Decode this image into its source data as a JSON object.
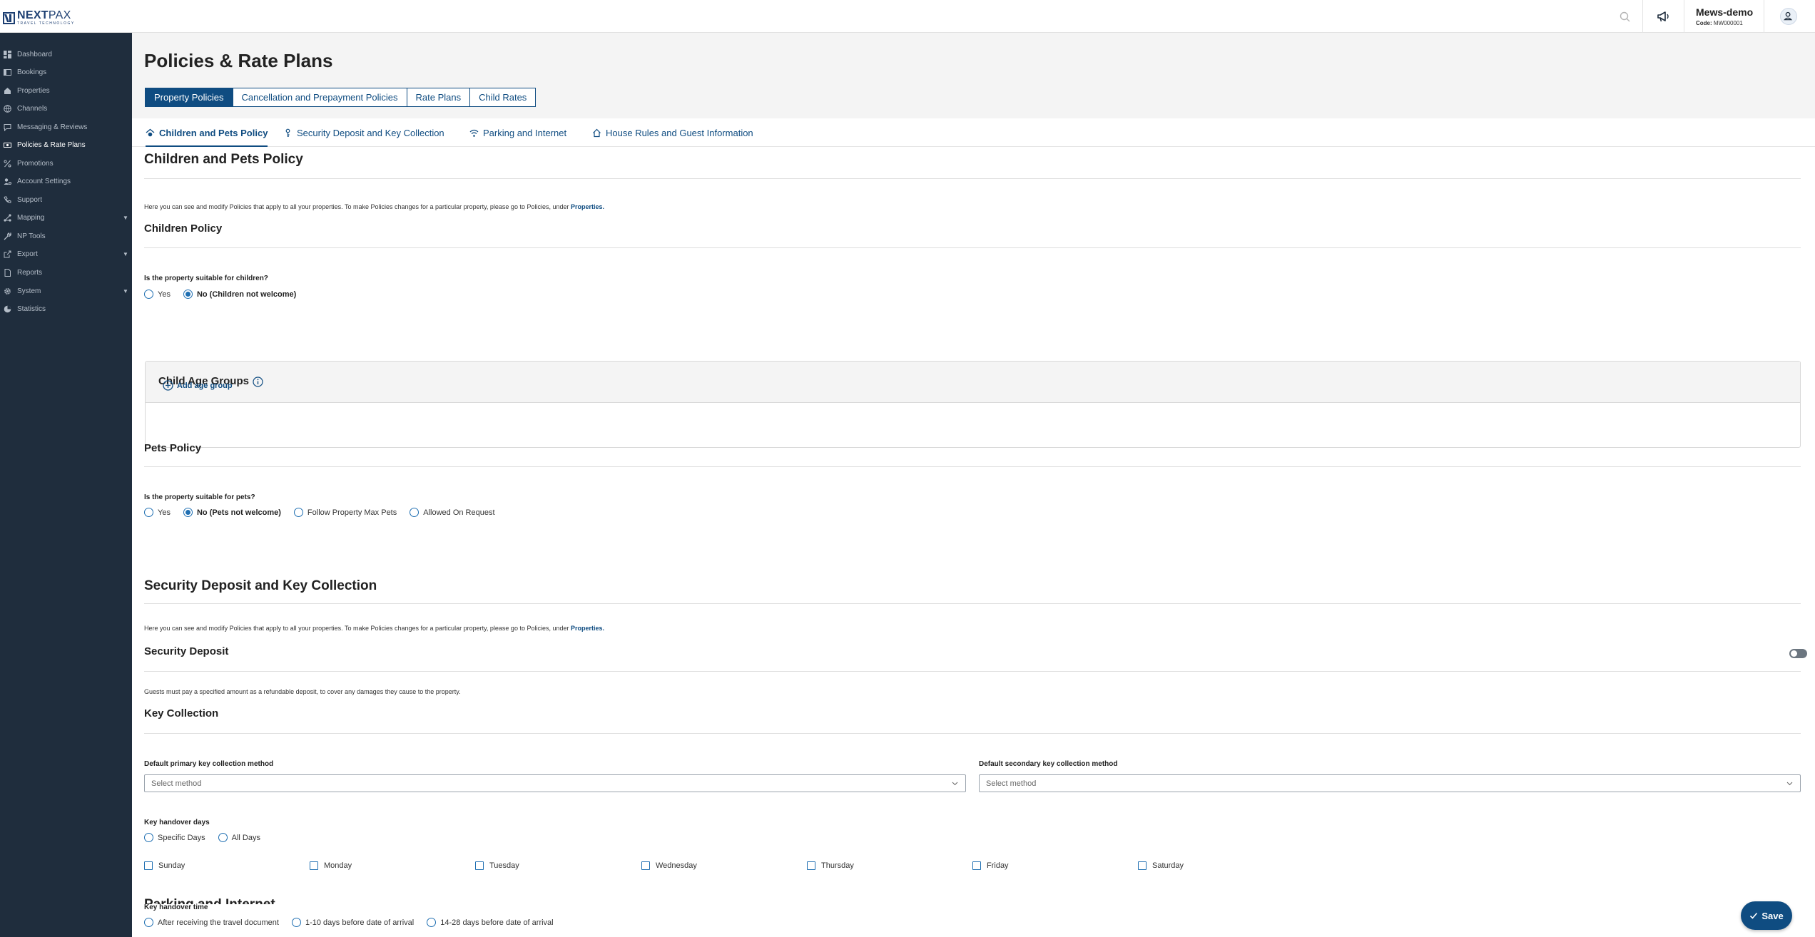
{
  "brand": {
    "name_bold": "NEXT",
    "name_light": "PAX",
    "tagline": "TRAVEL TECHNOLOGY"
  },
  "account": {
    "name": "Mews-demo",
    "code_label": "Code:",
    "code_value": "MW000001"
  },
  "sidebar": {
    "items": [
      {
        "label": "Dashboard",
        "icon": "dashboard-icon"
      },
      {
        "label": "Bookings",
        "icon": "bookings-icon"
      },
      {
        "label": "Properties",
        "icon": "properties-icon"
      },
      {
        "label": "Channels",
        "icon": "globe-icon"
      },
      {
        "label": "Messaging & Reviews",
        "icon": "chat-icon"
      },
      {
        "label": "Policies & Rate Plans",
        "icon": "money-icon",
        "active": true
      },
      {
        "label": "Promotions",
        "icon": "percent-icon"
      },
      {
        "label": "Account Settings",
        "icon": "account-settings-icon"
      },
      {
        "label": "Support",
        "icon": "phone-icon"
      },
      {
        "label": "Mapping",
        "icon": "mapping-icon",
        "expandable": true
      },
      {
        "label": "NP Tools",
        "icon": "wrench-icon"
      },
      {
        "label": "Export",
        "icon": "export-icon",
        "expandable": true
      },
      {
        "label": "Reports",
        "icon": "report-icon"
      },
      {
        "label": "System",
        "icon": "gear-icon",
        "expandable": true
      },
      {
        "label": "Statistics",
        "icon": "statistics-icon"
      }
    ]
  },
  "page": {
    "title": "Policies & Rate Plans",
    "tabs": [
      {
        "label": "Property Policies",
        "active": true
      },
      {
        "label": "Cancellation and Prepayment Policies"
      },
      {
        "label": "Rate Plans"
      },
      {
        "label": "Child Rates"
      }
    ],
    "subtabs": [
      {
        "label": "Children and Pets Policy",
        "active": true,
        "icon": "children-pets-icon"
      },
      {
        "label": "Security Deposit and Key Collection",
        "icon": "key-icon"
      },
      {
        "label": "Parking and Internet",
        "icon": "wifi-icon"
      },
      {
        "label": "House Rules and Guest Information",
        "icon": "house-icon"
      }
    ]
  },
  "children_pets": {
    "title": "Children and Pets Policy",
    "note": "Here you can see and modify Policies that apply to all your properties. To make Policies changes for a particular property, please go to Policies, under",
    "note_link": "Properties.",
    "children": {
      "title": "Children Policy",
      "question": "Is the property suitable for children?",
      "options": [
        "Yes",
        "No (Children not welcome)"
      ],
      "selected": "No (Children not welcome)"
    },
    "age_groups": {
      "title": "Child Age Groups",
      "add_label": "Add age group"
    },
    "pets": {
      "title": "Pets Policy",
      "question": "Is the property suitable for pets?",
      "options": [
        "Yes",
        "No (Pets not welcome)",
        "Follow Property Max Pets",
        "Allowed On Request"
      ],
      "selected": "No (Pets not welcome)"
    }
  },
  "security_key": {
    "title": "Security Deposit and Key Collection",
    "note": "Here you can see and modify Policies that apply to all your properties. To make Policies changes for a particular property, please go to Policies, under",
    "note_link": "Properties.",
    "deposit": {
      "title": "Security Deposit",
      "enabled": false,
      "description": "Guests must pay a specified amount as a refundable deposit, to cover any damages they cause to the property."
    },
    "key_collection": {
      "title": "Key Collection",
      "primary_label": "Default primary key collection method",
      "primary_placeholder": "Select method",
      "secondary_label": "Default secondary key collection method",
      "secondary_placeholder": "Select method",
      "handover_days_label": "Key handover days",
      "handover_days_options": [
        "Specific Days",
        "All Days"
      ],
      "days": [
        "Sunday",
        "Monday",
        "Tuesday",
        "Wednesday",
        "Thursday",
        "Friday",
        "Saturday"
      ],
      "handover_time_label": "Key handover time",
      "handover_time_options": [
        "After receiving the travel document",
        "1-10 days before date of arrival",
        "14-28 days before date of arrival"
      ]
    }
  },
  "next_section_title": "Parking and Internet",
  "save_label": "Save",
  "colors": {
    "sidebar_bg": "#1f2d3d",
    "accent": "#0f4c81",
    "radio": "#1f6fb2"
  }
}
